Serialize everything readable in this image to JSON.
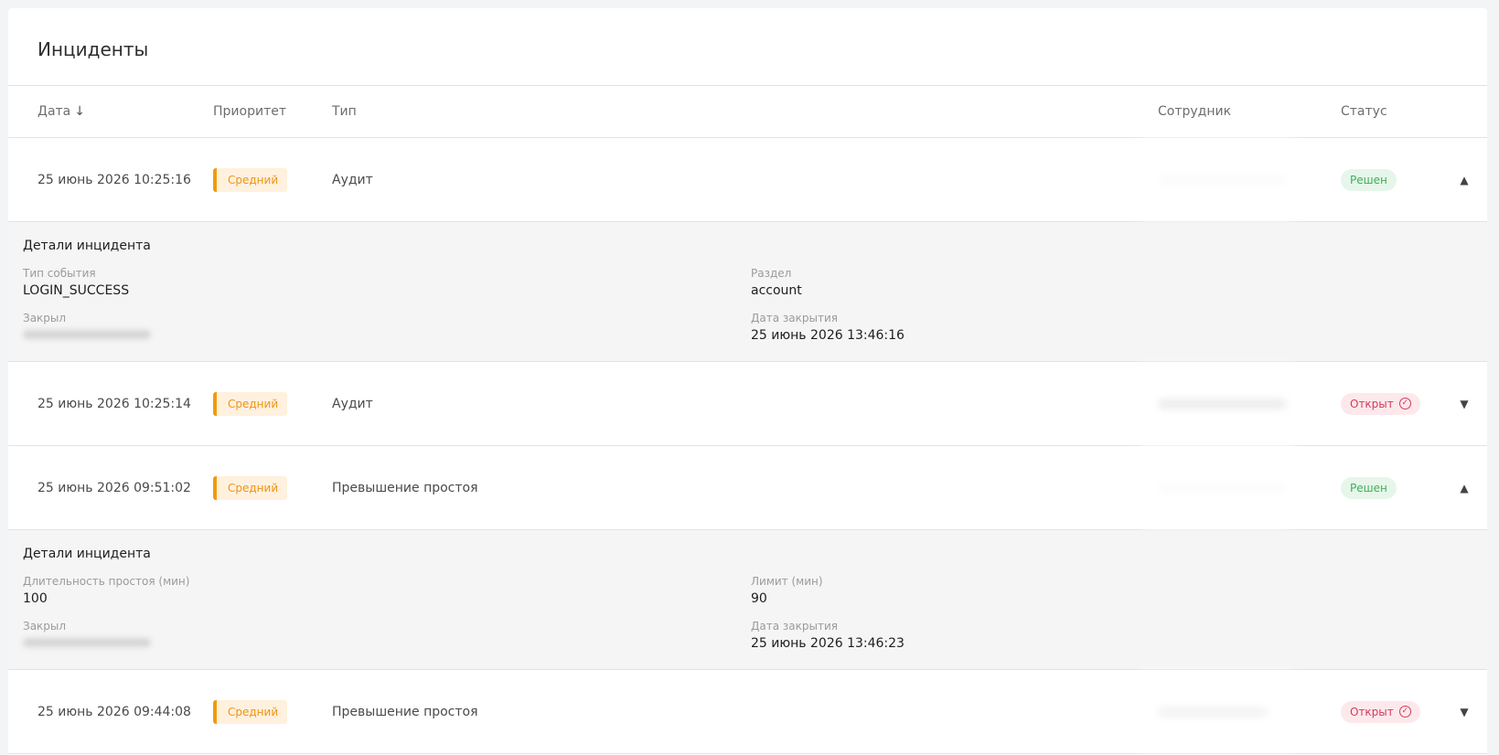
{
  "title": "Инциденты",
  "columns": {
    "date": "Дата",
    "date_sort_icon": "↓",
    "priority": "Приоритет",
    "type": "Тип",
    "employee": "Сотрудник",
    "status": "Статус"
  },
  "rows": [
    {
      "date": "25 июнь 2026 10:25:16",
      "priority": "Средний",
      "type": "Аудит",
      "status": "Решен",
      "status_kind": "resolved",
      "expanded": true,
      "chevron": "▲",
      "details": {
        "title": "Детали инцидента",
        "left_label": "Тип события",
        "left_value": "LOGIN_SUCCESS",
        "right_label": "Раздел",
        "right_value": "account",
        "closed_label": "Закрыл",
        "closed_date_label": "Дата закрытия",
        "closed_date_value": "25 июнь 2026 13:46:16"
      }
    },
    {
      "date": "25 июнь 2026 10:25:14",
      "priority": "Средний",
      "type": "Аудит",
      "status": "Открыт",
      "status_kind": "open",
      "expanded": false,
      "chevron": "▼"
    },
    {
      "date": "25 июнь 2026 09:51:02",
      "priority": "Средний",
      "type": "Превышение простоя",
      "status": "Решен",
      "status_kind": "resolved",
      "expanded": true,
      "chevron": "▲",
      "details": {
        "title": "Детали инцидента",
        "left_label": "Длительность простоя (мин)",
        "left_value": "100",
        "right_label": "Лимит (мин)",
        "right_value": "90",
        "closed_label": "Закрыл",
        "closed_date_label": "Дата закрытия",
        "closed_date_value": "25 июнь 2026 13:46:23"
      }
    },
    {
      "date": "25 июнь 2026 09:44:08",
      "priority": "Средний",
      "type": "Превышение простоя",
      "status": "Открыт",
      "status_kind": "open",
      "expanded": false,
      "chevron": "▼"
    }
  ],
  "colors": {
    "priority_medium": "#ef9412",
    "status_resolved": "#3fae5b",
    "status_open": "#d33b57"
  }
}
